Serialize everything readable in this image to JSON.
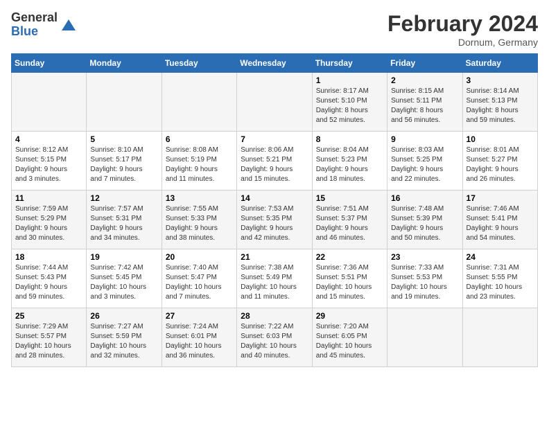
{
  "header": {
    "logo_general": "General",
    "logo_blue": "Blue",
    "month_title": "February 2024",
    "location": "Dornum, Germany"
  },
  "days_of_week": [
    "Sunday",
    "Monday",
    "Tuesday",
    "Wednesday",
    "Thursday",
    "Friday",
    "Saturday"
  ],
  "weeks": [
    {
      "days": [
        {
          "num": "",
          "info": ""
        },
        {
          "num": "",
          "info": ""
        },
        {
          "num": "",
          "info": ""
        },
        {
          "num": "",
          "info": ""
        },
        {
          "num": "1",
          "info": "Sunrise: 8:17 AM\nSunset: 5:10 PM\nDaylight: 8 hours\nand 52 minutes."
        },
        {
          "num": "2",
          "info": "Sunrise: 8:15 AM\nSunset: 5:11 PM\nDaylight: 8 hours\nand 56 minutes."
        },
        {
          "num": "3",
          "info": "Sunrise: 8:14 AM\nSunset: 5:13 PM\nDaylight: 8 hours\nand 59 minutes."
        }
      ]
    },
    {
      "days": [
        {
          "num": "4",
          "info": "Sunrise: 8:12 AM\nSunset: 5:15 PM\nDaylight: 9 hours\nand 3 minutes."
        },
        {
          "num": "5",
          "info": "Sunrise: 8:10 AM\nSunset: 5:17 PM\nDaylight: 9 hours\nand 7 minutes."
        },
        {
          "num": "6",
          "info": "Sunrise: 8:08 AM\nSunset: 5:19 PM\nDaylight: 9 hours\nand 11 minutes."
        },
        {
          "num": "7",
          "info": "Sunrise: 8:06 AM\nSunset: 5:21 PM\nDaylight: 9 hours\nand 15 minutes."
        },
        {
          "num": "8",
          "info": "Sunrise: 8:04 AM\nSunset: 5:23 PM\nDaylight: 9 hours\nand 18 minutes."
        },
        {
          "num": "9",
          "info": "Sunrise: 8:03 AM\nSunset: 5:25 PM\nDaylight: 9 hours\nand 22 minutes."
        },
        {
          "num": "10",
          "info": "Sunrise: 8:01 AM\nSunset: 5:27 PM\nDaylight: 9 hours\nand 26 minutes."
        }
      ]
    },
    {
      "days": [
        {
          "num": "11",
          "info": "Sunrise: 7:59 AM\nSunset: 5:29 PM\nDaylight: 9 hours\nand 30 minutes."
        },
        {
          "num": "12",
          "info": "Sunrise: 7:57 AM\nSunset: 5:31 PM\nDaylight: 9 hours\nand 34 minutes."
        },
        {
          "num": "13",
          "info": "Sunrise: 7:55 AM\nSunset: 5:33 PM\nDaylight: 9 hours\nand 38 minutes."
        },
        {
          "num": "14",
          "info": "Sunrise: 7:53 AM\nSunset: 5:35 PM\nDaylight: 9 hours\nand 42 minutes."
        },
        {
          "num": "15",
          "info": "Sunrise: 7:51 AM\nSunset: 5:37 PM\nDaylight: 9 hours\nand 46 minutes."
        },
        {
          "num": "16",
          "info": "Sunrise: 7:48 AM\nSunset: 5:39 PM\nDaylight: 9 hours\nand 50 minutes."
        },
        {
          "num": "17",
          "info": "Sunrise: 7:46 AM\nSunset: 5:41 PM\nDaylight: 9 hours\nand 54 minutes."
        }
      ]
    },
    {
      "days": [
        {
          "num": "18",
          "info": "Sunrise: 7:44 AM\nSunset: 5:43 PM\nDaylight: 9 hours\nand 59 minutes."
        },
        {
          "num": "19",
          "info": "Sunrise: 7:42 AM\nSunset: 5:45 PM\nDaylight: 10 hours\nand 3 minutes."
        },
        {
          "num": "20",
          "info": "Sunrise: 7:40 AM\nSunset: 5:47 PM\nDaylight: 10 hours\nand 7 minutes."
        },
        {
          "num": "21",
          "info": "Sunrise: 7:38 AM\nSunset: 5:49 PM\nDaylight: 10 hours\nand 11 minutes."
        },
        {
          "num": "22",
          "info": "Sunrise: 7:36 AM\nSunset: 5:51 PM\nDaylight: 10 hours\nand 15 minutes."
        },
        {
          "num": "23",
          "info": "Sunrise: 7:33 AM\nSunset: 5:53 PM\nDaylight: 10 hours\nand 19 minutes."
        },
        {
          "num": "24",
          "info": "Sunrise: 7:31 AM\nSunset: 5:55 PM\nDaylight: 10 hours\nand 23 minutes."
        }
      ]
    },
    {
      "days": [
        {
          "num": "25",
          "info": "Sunrise: 7:29 AM\nSunset: 5:57 PM\nDaylight: 10 hours\nand 28 minutes."
        },
        {
          "num": "26",
          "info": "Sunrise: 7:27 AM\nSunset: 5:59 PM\nDaylight: 10 hours\nand 32 minutes."
        },
        {
          "num": "27",
          "info": "Sunrise: 7:24 AM\nSunset: 6:01 PM\nDaylight: 10 hours\nand 36 minutes."
        },
        {
          "num": "28",
          "info": "Sunrise: 7:22 AM\nSunset: 6:03 PM\nDaylight: 10 hours\nand 40 minutes."
        },
        {
          "num": "29",
          "info": "Sunrise: 7:20 AM\nSunset: 6:05 PM\nDaylight: 10 hours\nand 45 minutes."
        },
        {
          "num": "",
          "info": ""
        },
        {
          "num": "",
          "info": ""
        }
      ]
    }
  ]
}
